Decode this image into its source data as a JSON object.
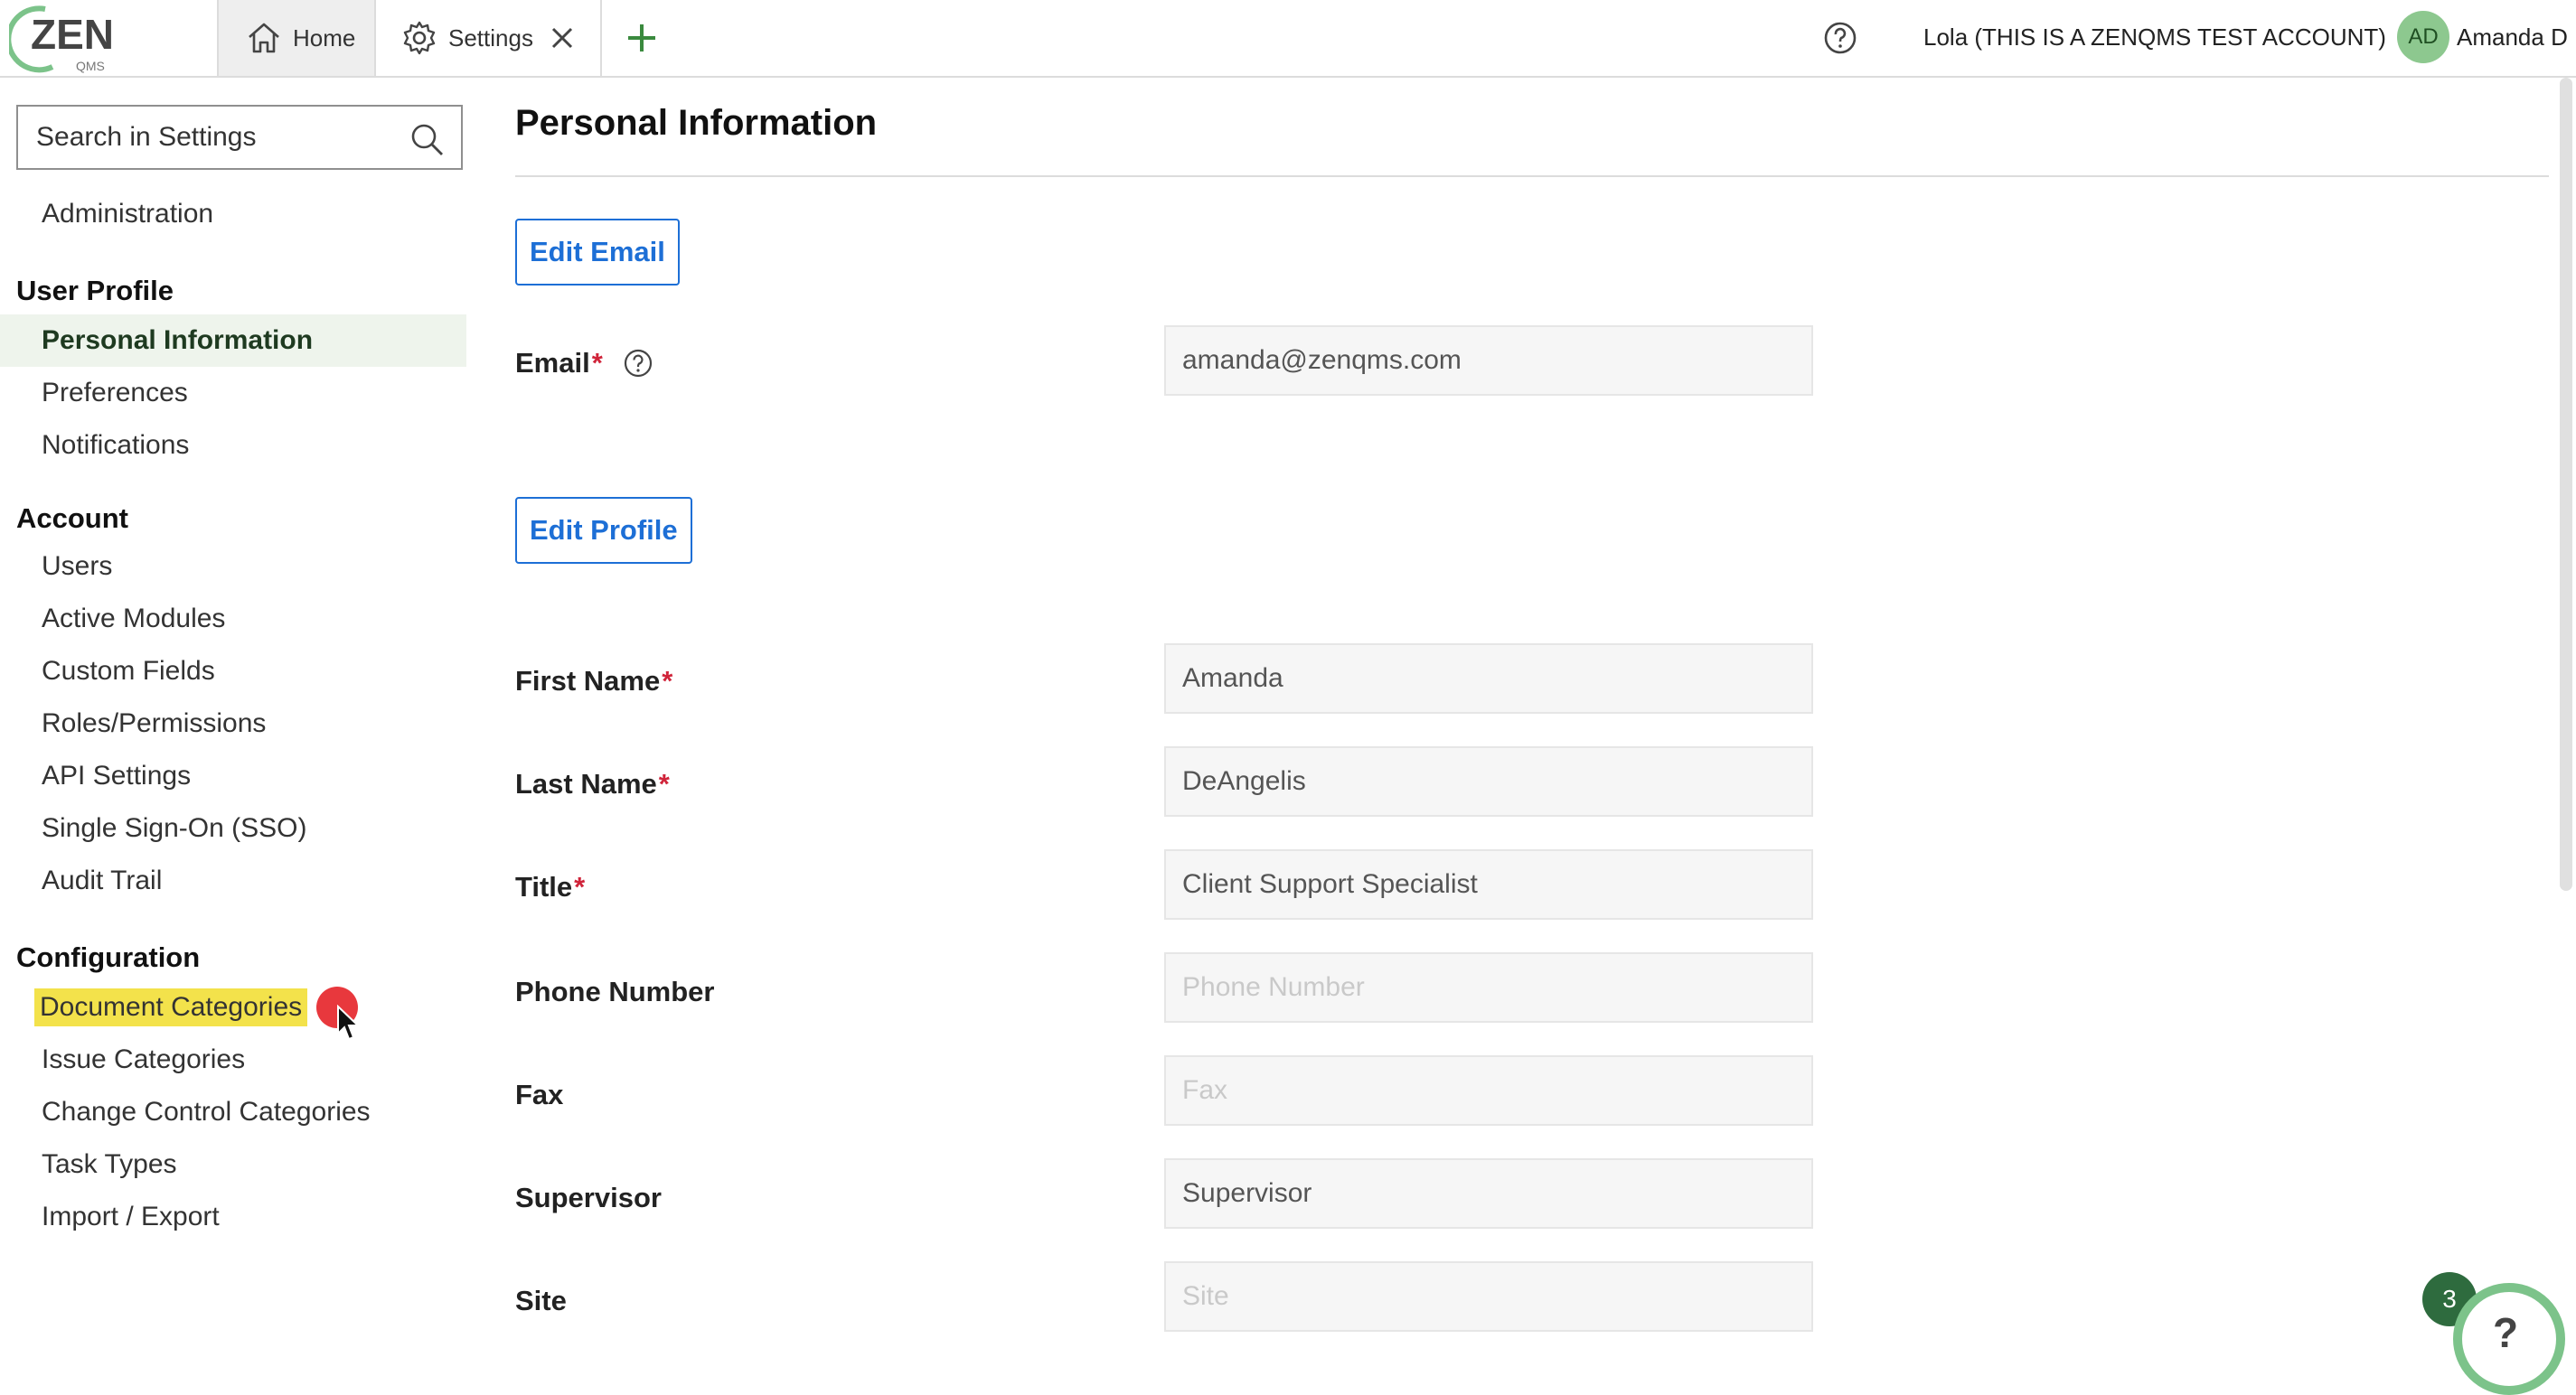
{
  "topbar": {
    "logo_text": "ZEN",
    "logo_subtext": "QMS",
    "tabs": [
      {
        "label": "Home",
        "icon": "home-icon"
      },
      {
        "label": "Settings",
        "icon": "gear-icon"
      }
    ],
    "account_name": "Lola (THIS IS A ZENQMS TEST ACCOUNT)",
    "avatar_initials": "AD",
    "user_name": "Amanda D"
  },
  "sidebar": {
    "search_placeholder": "Search in Settings",
    "administration": "Administration",
    "sections": [
      {
        "title": "User Profile",
        "items": [
          "Personal Information",
          "Preferences",
          "Notifications"
        ]
      },
      {
        "title": "Account",
        "items": [
          "Users",
          "Active Modules",
          "Custom Fields",
          "Roles/Permissions",
          "API Settings",
          "Single Sign-On (SSO)",
          "Audit Trail"
        ]
      },
      {
        "title": "Configuration",
        "items": [
          "Document Categories",
          "Issue Categories",
          "Change Control Categories",
          "Task Types",
          "Import / Export"
        ]
      }
    ],
    "active_item": "Personal Information",
    "highlighted_item": "Document Categories"
  },
  "main": {
    "title": "Personal Information",
    "edit_email_label": "Edit Email",
    "edit_profile_label": "Edit Profile",
    "email": {
      "label": "Email",
      "value": "amanda@zenqms.com"
    },
    "fields": [
      {
        "label": "First Name",
        "required": true,
        "value": "Amanda",
        "placeholder": ""
      },
      {
        "label": "Last Name",
        "required": true,
        "value": "DeAngelis",
        "placeholder": ""
      },
      {
        "label": "Title",
        "required": true,
        "value": "Client Support Specialist",
        "placeholder": ""
      },
      {
        "label": "Phone Number",
        "required": false,
        "value": "",
        "placeholder": "Phone Number"
      },
      {
        "label": "Fax",
        "required": false,
        "value": "",
        "placeholder": "Fax"
      },
      {
        "label": "Supervisor",
        "required": false,
        "value": "",
        "placeholder": "Supervisor"
      },
      {
        "label": "Site",
        "required": false,
        "value": "",
        "placeholder": "Site"
      }
    ],
    "required_marker": "*"
  },
  "widgets": {
    "notification_count": "3",
    "help_symbol": "?"
  },
  "colors": {
    "accent_blue": "#1d6fd6",
    "logo_green": "#7cc38a",
    "required_red": "#d0243a",
    "highlight_yellow": "#f3e24b"
  }
}
